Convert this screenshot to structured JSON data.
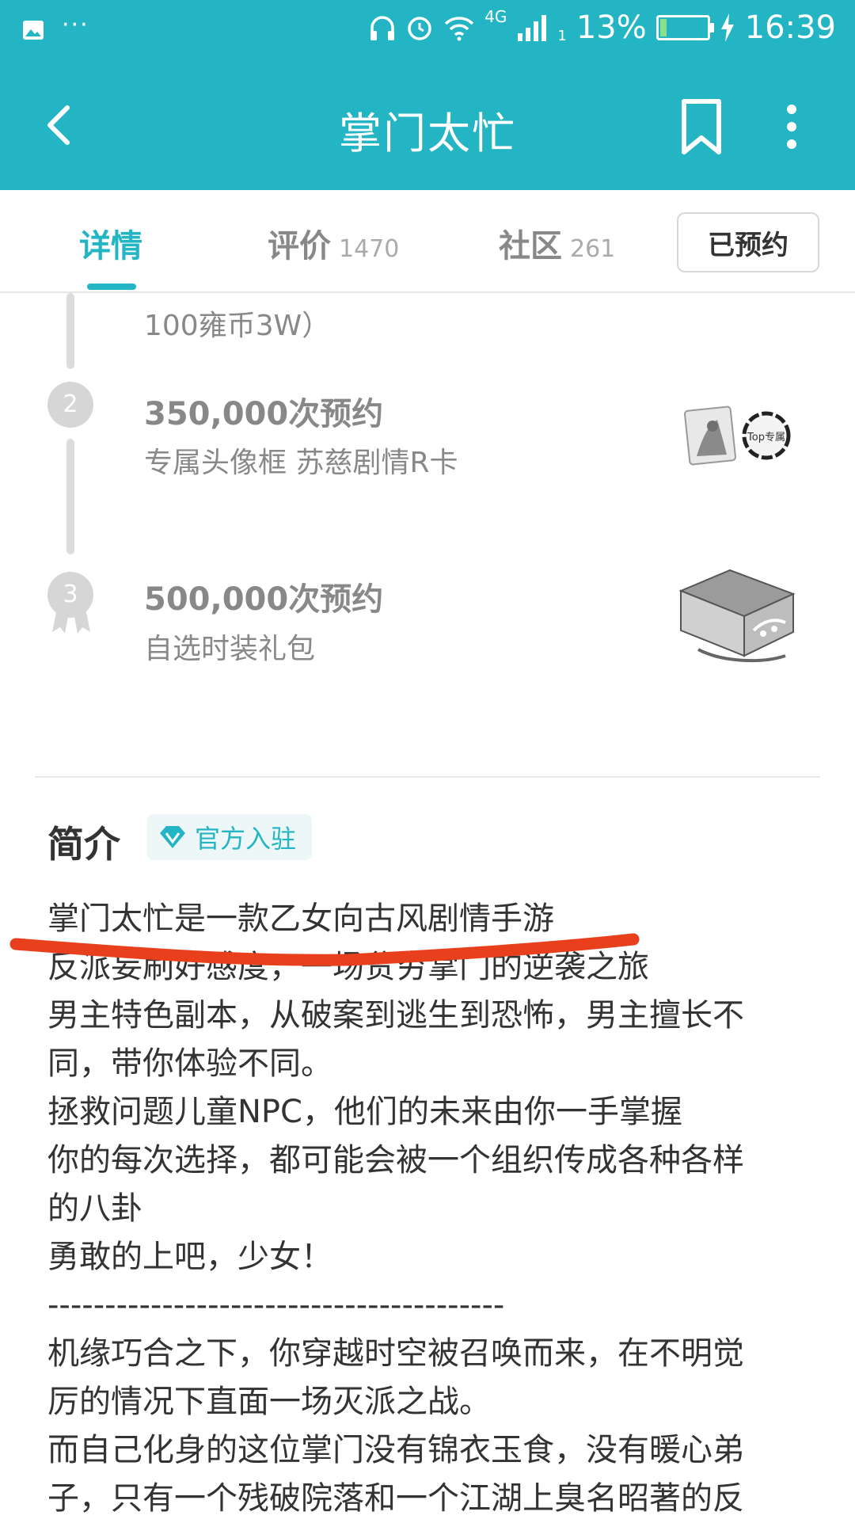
{
  "status_bar": {
    "network": "4G",
    "sim_slot": "1",
    "battery_percent": "13%",
    "battery_level": 0.13,
    "time": "16:39",
    "left_icons": [
      "image-icon",
      "more-dots-icon"
    ],
    "right_icons": [
      "headphones-icon",
      "alarm-icon",
      "wifi-icon",
      "signal-icon",
      "battery-icon",
      "charging-icon"
    ]
  },
  "toolbar": {
    "title": "掌门太忙",
    "icons": [
      "back-icon",
      "bookmark-icon",
      "more-vertical-icon"
    ]
  },
  "tabs": [
    {
      "label": "详情",
      "count": ""
    },
    {
      "label": "评价",
      "count": "1470"
    },
    {
      "label": "社区",
      "count": "261"
    }
  ],
  "reserve_button": "已预约",
  "milestones": [
    {
      "badge": "",
      "title": "",
      "reward": "100雍币3W）"
    },
    {
      "badge": "2",
      "title": "350,000次预约",
      "reward": "专属头像框 苏慈剧情R卡"
    },
    {
      "badge": "3",
      "title": "500,000次预约",
      "reward": "自选时装礼包"
    }
  ],
  "reward_image_text": "Top专属",
  "intro": {
    "heading": "简介",
    "badge": "官方入驻",
    "lines": [
      "掌门太忙是一款乙女向古风剧情手游",
      "反派妄刷好感度，一场贫穷掌门的逆袭之旅",
      "男主特色副本，从破案到逃生到恐怖，男主擅长不",
      "同，带你体验不同。",
      "拯救问题儿童NPC，他们的未来由你一手掌握",
      "你的每次选择，都可能会被一个组织传成各种各样",
      "的八卦",
      "勇敢的上吧，少女！",
      "----------------------------------------",
      "机缘巧合之下，你穿越时空被召唤而来，在不明觉",
      "厉的情况下直面一场灭派之战。",
      "而自己化身的这位掌门没有锦衣玉食，没有暖心弟",
      "子，只有一个残破院落和一个江湖上臭名昭著的反"
    ]
  },
  "colors": {
    "accent": "#23b5c3",
    "annotation": "#e8401c"
  }
}
